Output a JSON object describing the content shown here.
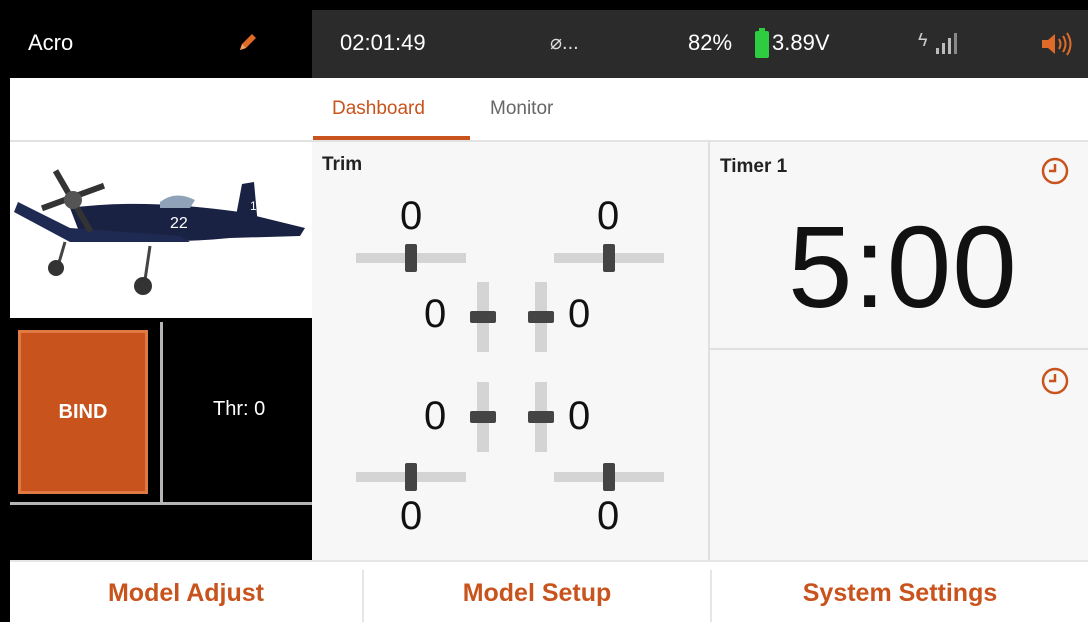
{
  "status": {
    "model_name": "Acro",
    "time": "02:01:49",
    "link": "⌀...",
    "battery_percent": "82%",
    "voltage": "3.89V",
    "signal_symbol": "ϟ",
    "colors": {
      "accent": "#c9531d",
      "battery": "#2ecc40"
    }
  },
  "tabs": [
    {
      "label": "Dashboard",
      "active": true
    },
    {
      "label": "Monitor",
      "active": false
    }
  ],
  "left": {
    "bind_label": "BIND",
    "throttle_label": "Thr: 0"
  },
  "trim": {
    "title": "Trim",
    "top_left": "0",
    "top_right": "0",
    "mid_upper_left": "0",
    "mid_upper_right": "0",
    "mid_lower_left": "0",
    "mid_lower_right": "0",
    "bottom_left": "0",
    "bottom_right": "0"
  },
  "timer": {
    "title": "Timer 1",
    "value": "5:00"
  },
  "bottom": {
    "model_adjust": "Model Adjust",
    "model_setup": "Model Setup",
    "system_settings": "System Settings"
  },
  "icons": [
    "pencil-icon",
    "link-icon",
    "battery-icon",
    "signal-icon",
    "speaker-icon",
    "clock-icon"
  ]
}
